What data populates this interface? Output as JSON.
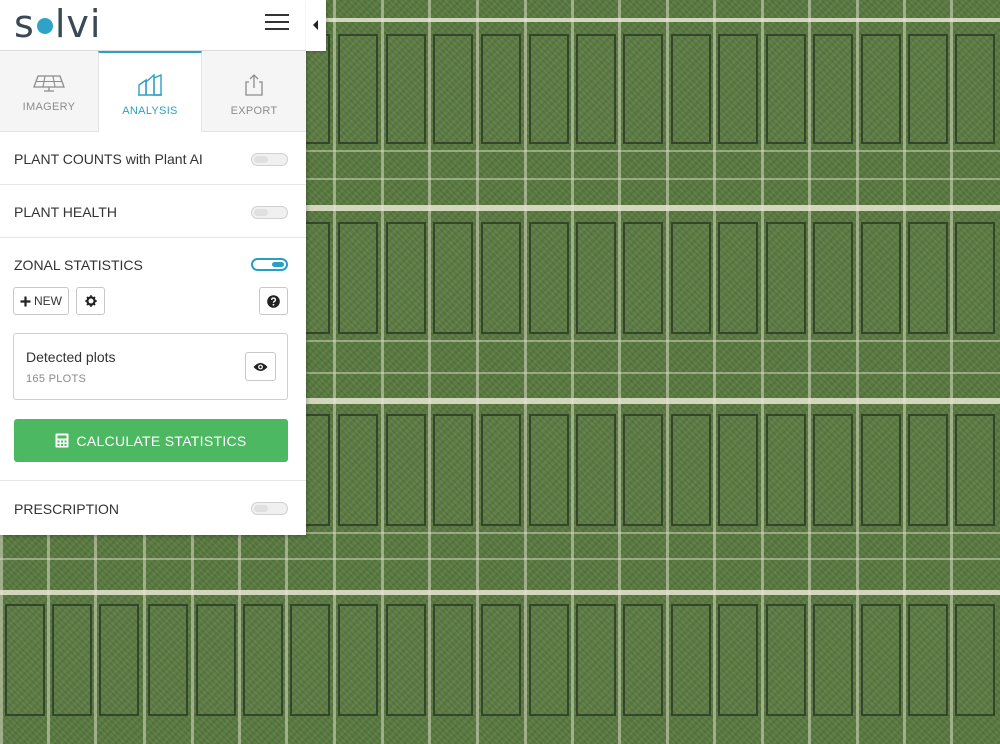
{
  "app": {
    "logo_text_start": "s",
    "logo_text_end": "lvi"
  },
  "tabs": [
    {
      "label": "IMAGERY",
      "icon": "solar-grid-icon",
      "active": false
    },
    {
      "label": "ANALYSIS",
      "icon": "analysis-chart-icon",
      "active": true
    },
    {
      "label": "EXPORT",
      "icon": "export-share-icon",
      "active": false
    }
  ],
  "sections": {
    "plant_counts": {
      "label": "PLANT COUNTS with Plant AI",
      "enabled": false
    },
    "plant_health": {
      "label": "PLANT HEALTH",
      "enabled": false
    },
    "zonal_statistics": {
      "label": "ZONAL STATISTICS",
      "enabled": true,
      "new_button_label": "NEW",
      "detected_plots": {
        "title": "Detected plots",
        "count_label": "165 PLOTS"
      },
      "calculate_button_label": "CALCULATE STATISTICS"
    },
    "prescription": {
      "label": "PRESCRIPTION",
      "enabled": false
    }
  },
  "colors": {
    "accent": "#2ea0c4",
    "calculate_button": "#4cb962",
    "map_field": "#5a7a40"
  }
}
